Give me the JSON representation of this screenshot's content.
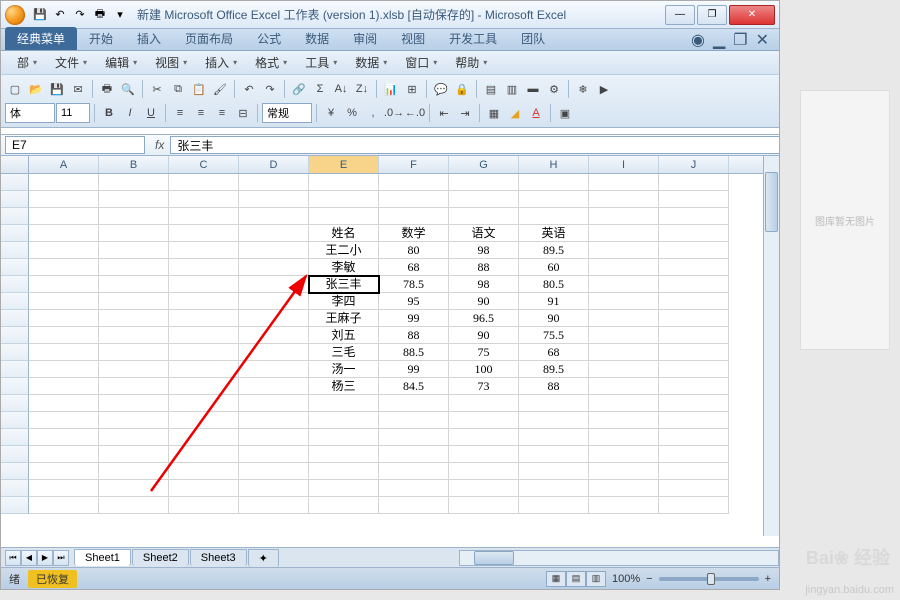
{
  "title": "新建 Microsoft Office Excel 工作表 (version 1).xlsb [自动保存的] - Microsoft Excel",
  "ribbon": {
    "tabs": [
      "经典菜单",
      "开始",
      "插入",
      "页面布局",
      "公式",
      "数据",
      "审阅",
      "视图",
      "开发工具",
      "团队"
    ],
    "active": 0
  },
  "menubar": [
    "部",
    "文件",
    "编辑",
    "视图",
    "插入",
    "格式",
    "工具",
    "数据",
    "窗口",
    "帮助"
  ],
  "toolbar2": {
    "font": "体",
    "size": "11"
  },
  "namebox": "E7",
  "formula": "张三丰",
  "columns": [
    "A",
    "B",
    "C",
    "D",
    "E",
    "F",
    "G",
    "H",
    "I",
    "J"
  ],
  "chart_data": {
    "type": "table",
    "title": "",
    "columns": [
      "姓名",
      "数学",
      "语文",
      "英语"
    ],
    "rows": [
      {
        "姓名": "王二小",
        "数学": 80,
        "语文": 98,
        "英语": 89.5
      },
      {
        "姓名": "李敏",
        "数学": 68,
        "语文": 88,
        "英语": 60
      },
      {
        "姓名": "张三丰",
        "数学": 78.5,
        "语文": 98,
        "英语": 80.5
      },
      {
        "姓名": "李四",
        "数学": 95,
        "语文": 90,
        "英语": 91
      },
      {
        "姓名": "王麻子",
        "数学": 99,
        "语文": 96.5,
        "英语": 90
      },
      {
        "姓名": "刘五",
        "数学": 88,
        "语文": 90,
        "英语": 75.5
      },
      {
        "姓名": "三毛",
        "数学": 88.5,
        "语文": 75,
        "英语": 68
      },
      {
        "姓名": "汤一",
        "数学": 99,
        "语文": 100,
        "英语": 89.5
      },
      {
        "姓名": "杨三",
        "数学": 84.5,
        "语文": 73,
        "英语": 88
      }
    ],
    "header_row": 4,
    "start_col": "E",
    "selected_cell": "E7",
    "selected_value": "张三丰"
  },
  "sheets": [
    "Sheet1",
    "Sheet2",
    "Sheet3"
  ],
  "status": {
    "label": "绪",
    "recover": "已恢复",
    "zoom": "100%"
  },
  "side_placeholder": "图库暂无图片",
  "watermark": "jingyan.baidu.com",
  "baidu": "Bai❀ 经验"
}
